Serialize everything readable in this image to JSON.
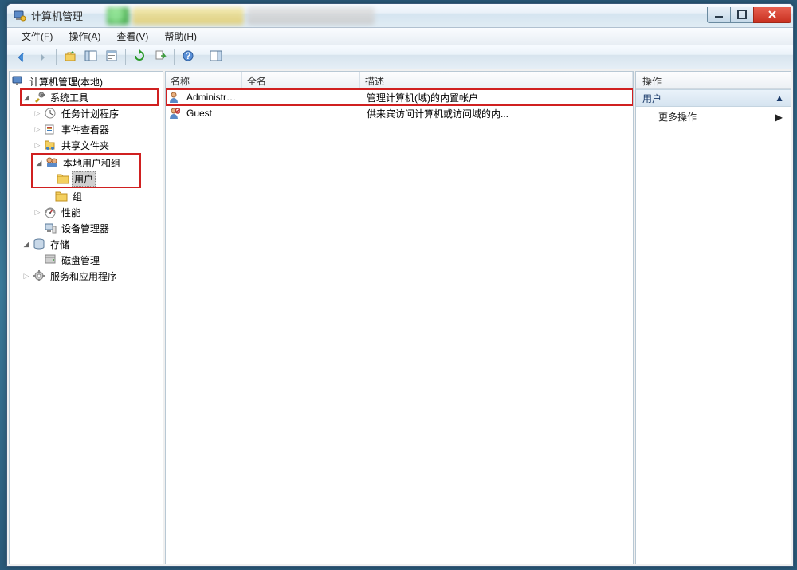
{
  "window": {
    "title": "计算机管理"
  },
  "menu": {
    "file": "文件(F)",
    "action": "操作(A)",
    "view": "查看(V)",
    "help": "帮助(H)"
  },
  "tree": {
    "root": "计算机管理(本地)",
    "system_tools": "系统工具",
    "task_scheduler": "任务计划程序",
    "event_viewer": "事件查看器",
    "shared_folders": "共享文件夹",
    "local_users_groups": "本地用户和组",
    "users": "用户",
    "groups": "组",
    "performance": "性能",
    "device_manager": "设备管理器",
    "storage": "存储",
    "disk_management": "磁盘管理",
    "services_apps": "服务和应用程序"
  },
  "list": {
    "cols": {
      "name": "名称",
      "fullname": "全名",
      "description": "描述"
    },
    "rows": [
      {
        "name": "Administrat...",
        "fullname": "",
        "description": "管理计算机(域)的内置帐户"
      },
      {
        "name": "Guest",
        "fullname": "",
        "description": "供来宾访问计算机或访问域的内..."
      }
    ]
  },
  "actions": {
    "header": "操作",
    "section": "用户",
    "more": "更多操作"
  },
  "colors": {
    "highlight": "#d02020"
  }
}
